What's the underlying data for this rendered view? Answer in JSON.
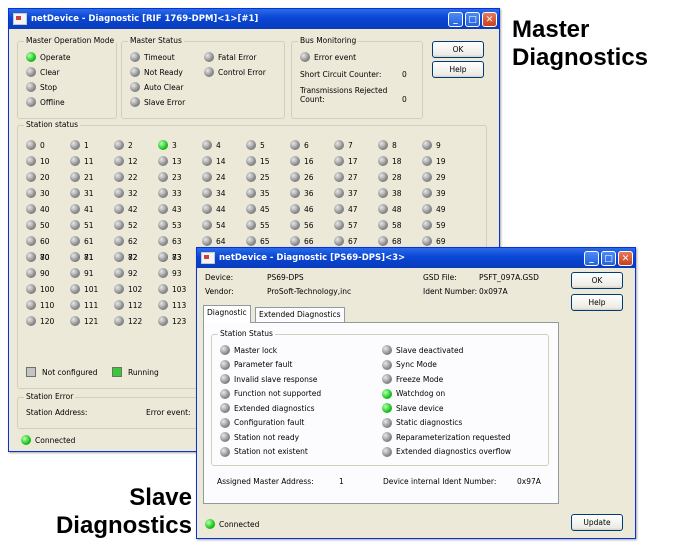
{
  "captions": {
    "master": "Master\nDiagnostics",
    "slave": "Slave\nDiagnostics"
  },
  "master_window": {
    "title": "netDevice - Diagnostic [RIF 1769-DPM]<1>[#1]",
    "ok_label": "OK",
    "help_label": "Help",
    "operation_mode": {
      "label": "Master Operation Mode",
      "items": [
        {
          "label": "Operate",
          "state": "green"
        },
        {
          "label": "Clear",
          "state": "gray"
        },
        {
          "label": "Stop",
          "state": "gray"
        },
        {
          "label": "Offline",
          "state": "gray"
        }
      ]
    },
    "master_status": {
      "label": "Master Status",
      "col1": [
        {
          "label": "Timeout",
          "state": "gray"
        },
        {
          "label": "Not Ready",
          "state": "gray"
        },
        {
          "label": "Auto Clear",
          "state": "gray"
        },
        {
          "label": "Slave Error",
          "state": "gray"
        }
      ],
      "col2": [
        {
          "label": "Fatal Error",
          "state": "gray"
        },
        {
          "label": "Control Error",
          "state": "gray"
        }
      ]
    },
    "bus_monitoring": {
      "label": "Bus Monitoring",
      "error_event": "Error event",
      "short_circuit_label": "Short Circuit Counter:",
      "short_circuit_value": "0",
      "rejected_label1": "Transmissions Rejected",
      "rejected_label2": "Count:",
      "rejected_value": "0"
    },
    "station_status": {
      "label": "Station status",
      "stations": [
        "0",
        "1",
        "2",
        "3",
        "4",
        "5",
        "6",
        "7",
        "8",
        "9",
        "10",
        "11",
        "12",
        "13",
        "14",
        "15",
        "16",
        "17",
        "18",
        "19",
        "20",
        "21",
        "22",
        "23",
        "24",
        "25",
        "26",
        "27",
        "28",
        "29",
        "30",
        "31",
        "32",
        "33",
        "34",
        "35",
        "36",
        "37",
        "38",
        "39",
        "40",
        "41",
        "42",
        "43",
        "44",
        "45",
        "46",
        "47",
        "48",
        "49",
        "50",
        "51",
        "52",
        "53",
        "54",
        "55",
        "56",
        "57",
        "58",
        "59",
        "60",
        "61",
        "62",
        "63",
        "64",
        "65",
        "66",
        "67",
        "68",
        "69",
        "70",
        "71",
        "72",
        "73",
        "80",
        "81",
        "82",
        "83",
        "90",
        "91",
        "92",
        "93",
        "100",
        "101",
        "102",
        "103",
        "110",
        "111",
        "112",
        "113",
        "120",
        "121",
        "122",
        "123"
      ],
      "green_station": "3",
      "legend_not_configured": "Not configured",
      "legend_running": "Running"
    },
    "station_error": {
      "label": "Station Error",
      "address_label": "Station Address:",
      "event_label": "Error event:"
    },
    "connected": "Connected"
  },
  "slave_window": {
    "title": "netDevice - Diagnostic [PS69-DPS]<3>",
    "ok_label": "OK",
    "help_label": "Help",
    "update_label": "Update",
    "device_label": "Device:",
    "device_value": "PS69-DPS",
    "vendor_label": "Vendor:",
    "vendor_value": "ProSoft-Technology,inc",
    "gsd_label": "GSD File:",
    "gsd_value": "PSFT_097A.GSD",
    "ident_label": "Ident Number:",
    "ident_value": "0x097A",
    "tabs": [
      "Diagnostic",
      "Extended Diagnostics"
    ],
    "station_status_label": "Station Status",
    "left_items": [
      {
        "label": "Master lock",
        "state": "gray"
      },
      {
        "label": "Parameter fault",
        "state": "gray"
      },
      {
        "label": "Invalid slave response",
        "state": "gray"
      },
      {
        "label": "Function not supported",
        "state": "gray"
      },
      {
        "label": "Extended diagnostics",
        "state": "gray"
      },
      {
        "label": "Configuration fault",
        "state": "gray"
      },
      {
        "label": "Station not ready",
        "state": "gray"
      },
      {
        "label": "Station not existent",
        "state": "gray"
      }
    ],
    "right_items": [
      {
        "label": "Slave deactivated",
        "state": "gray"
      },
      {
        "label": "Sync Mode",
        "state": "gray"
      },
      {
        "label": "Freeze Mode",
        "state": "gray"
      },
      {
        "label": "Watchdog on",
        "state": "green"
      },
      {
        "label": "Slave device",
        "state": "green"
      },
      {
        "label": "Static diagnostics",
        "state": "gray"
      },
      {
        "label": "Reparameterization requested",
        "state": "gray"
      },
      {
        "label": "Extended diagnostics overflow",
        "state": "gray"
      }
    ],
    "master_address_label": "Assigned Master Address:",
    "master_address_value": "1",
    "internal_ident_label": "Device internal Ident Number:",
    "internal_ident_value": "0x97A",
    "connected": "Connected"
  }
}
